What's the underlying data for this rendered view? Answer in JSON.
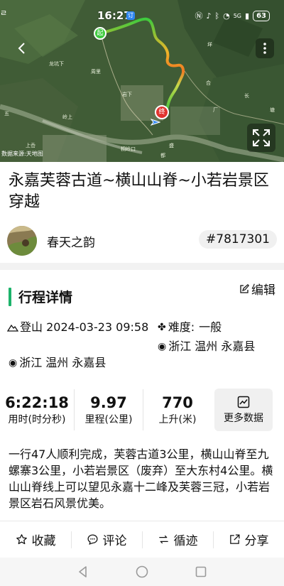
{
  "status_bar": {
    "left_text": "ㄹ\n竹",
    "time": "16:27",
    "app_badge": "订",
    "signal_5g": "5G",
    "battery": "63"
  },
  "map": {
    "source_label": "数据来源:天地图",
    "start_marker": "起",
    "end_marker": "终",
    "place_names": [
      "龙坑下",
      "周里",
      "岩下",
      "合",
      "垟",
      "五",
      "上岙",
      "厂",
      "塘",
      "桐岭口",
      "岭上",
      "长",
      "盛",
      "都"
    ],
    "icons": {
      "back": "chevron-left-icon",
      "more": "more-vertical-icon",
      "fullscreen": "expand-icon"
    }
  },
  "route": {
    "title": "永嘉芙蓉古道~横山山脊~小若岩景区穿越",
    "author": "春天之韵",
    "id": "#7817301"
  },
  "details": {
    "section_title": "行程详情",
    "edit_label": "编辑",
    "activity_type": "登山",
    "date": "2024-03-23 09:58",
    "difficulty_label": "难度:",
    "difficulty_value": "一般",
    "start_location": "浙江 温州 永嘉县",
    "end_location": "浙江 温州 永嘉县",
    "stats": [
      {
        "value": "6:22:18",
        "label": "用时(时分秒)"
      },
      {
        "value": "9.97",
        "label": "里程(公里)"
      },
      {
        "value": "770",
        "label": "上升(米)"
      }
    ],
    "more_data_label": "更多数据",
    "description": "一行47人顺利完成，芙蓉古道3公里，横山山脊至九螺寨3公里，小若岩景区（废弃）至大东村4公里。横山山脊线上可以望见永嘉十二峰及芙蓉三冠，小若岩景区岩石风景优美。"
  },
  "actions": [
    {
      "label": "收藏",
      "icon": "star-icon"
    },
    {
      "label": "评论",
      "icon": "comment-icon"
    },
    {
      "label": "循迹",
      "icon": "track-icon"
    },
    {
      "label": "分享",
      "icon": "share-icon"
    }
  ],
  "colors": {
    "accent": "#1db36b",
    "route_start": "#3ecb3e",
    "route_mid": "#f0b429",
    "route_end": "#e0342f"
  }
}
